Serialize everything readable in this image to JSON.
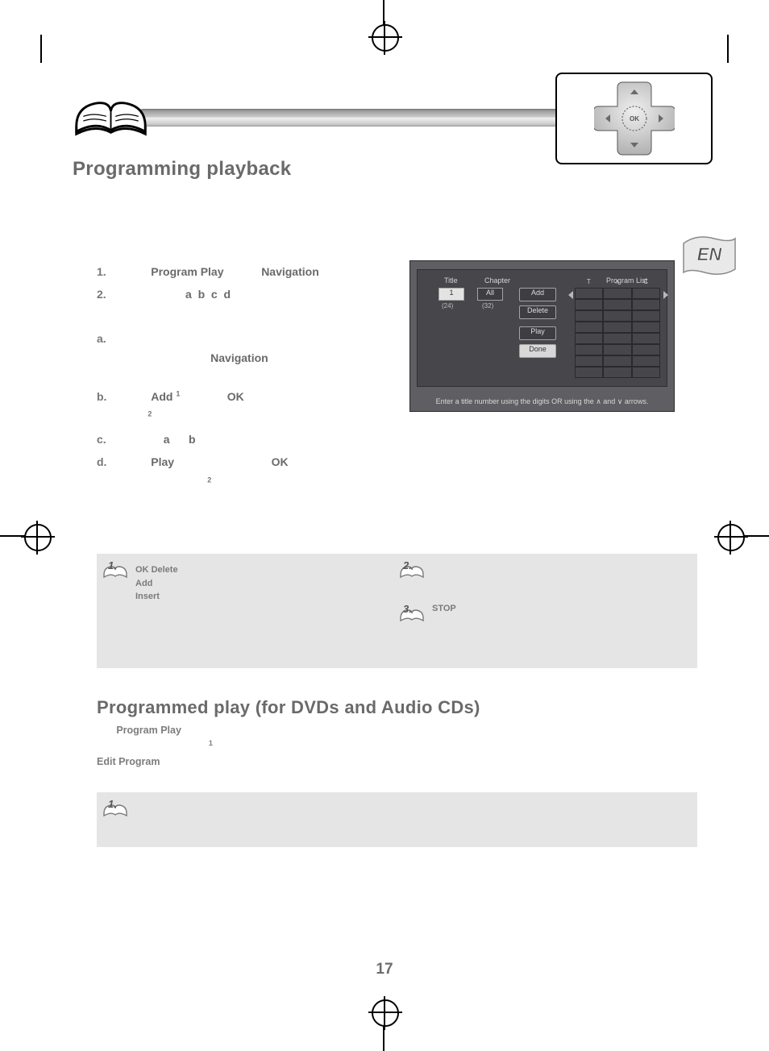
{
  "header": {
    "title": "Programming playback"
  },
  "lang_tab": "EN",
  "steps": {
    "s1": {
      "num": "1.",
      "a": "Program Play",
      "b": "Navigation"
    },
    "s2": {
      "num": "2.",
      "letters": "a  b  c  d"
    },
    "sa": {
      "num": "a.",
      "b": "Navigation"
    },
    "sb": {
      "num": "b.",
      "a": "Add",
      "sup1": "1",
      "b": "OK",
      "sup2": "2"
    },
    "sc": {
      "num": "c.",
      "a": "a",
      "b": "b"
    },
    "sd": {
      "num": "d.",
      "a": "Play",
      "b": "OK",
      "sup2": "2"
    }
  },
  "screenshot": {
    "title_label": "Title",
    "chapter_label": "Chapter",
    "proglist_label": "Program List",
    "title_box": "1",
    "chapter_box": "All",
    "title_count": "(24)",
    "chapter_count": "(32)",
    "btn_add": "Add",
    "btn_delete": "Delete",
    "btn_play": "Play",
    "btn_done": "Done",
    "table_head": {
      "t": "T",
      "c": "C"
    },
    "footer": "Enter a title number using the digits OR using the ∧ and ∨ arrows."
  },
  "tips": {
    "t1": {
      "num": "1.",
      "ok": "OK",
      "del": "Delete",
      "add": "Add",
      "ins": "Insert"
    },
    "t2": {
      "num": "2."
    },
    "t3": {
      "num": "3.",
      "stop": "STOP"
    }
  },
  "section2": {
    "title": "Programmed play (for DVDs and Audio CDs)",
    "program_play": "Program Play",
    "sup1": "1",
    "edit_program": "Edit Program"
  },
  "tip3box": {
    "num": "1."
  },
  "page_number": "17"
}
